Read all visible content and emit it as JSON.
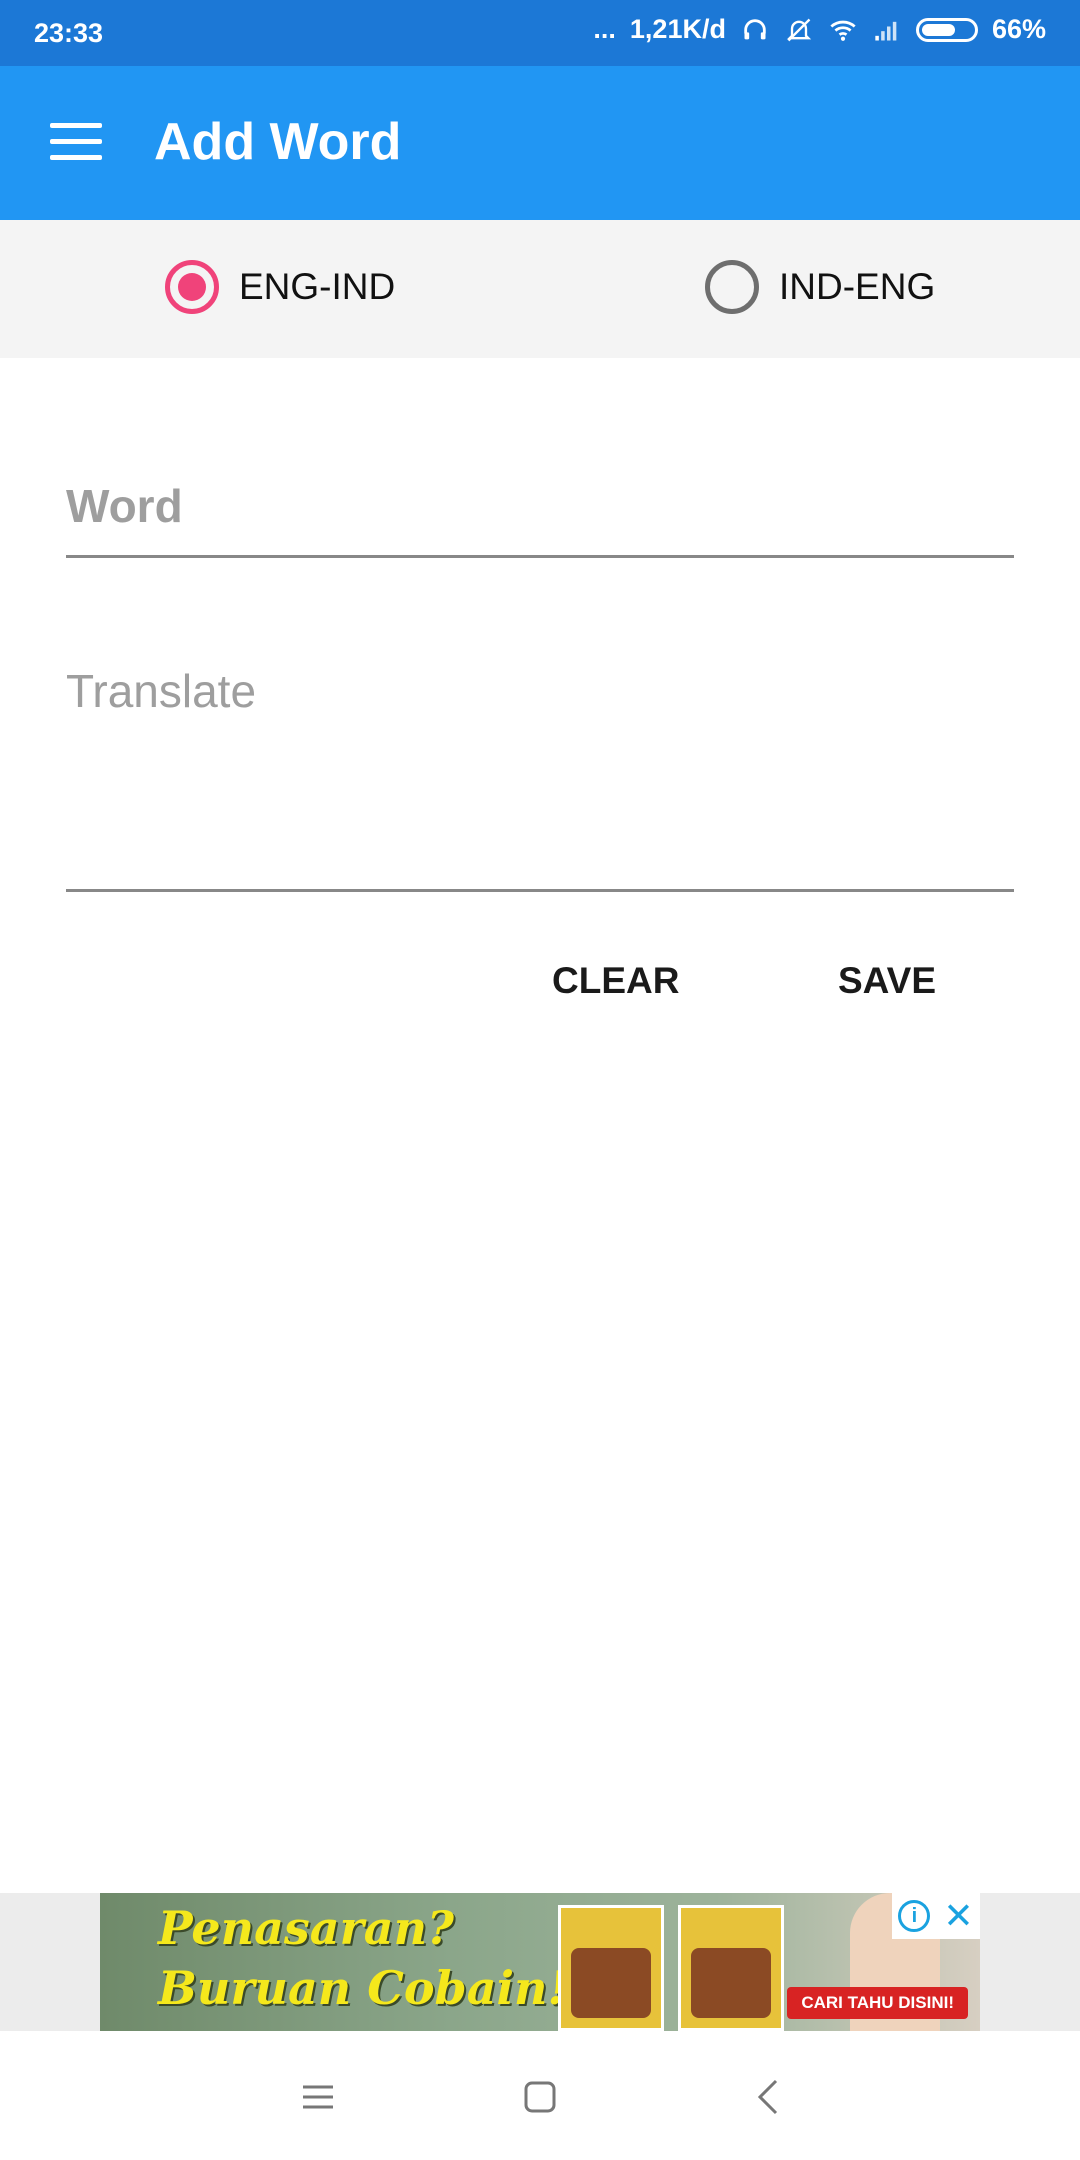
{
  "status_bar": {
    "time": "23:33",
    "more": "...",
    "network_speed": "1,21K/d",
    "battery_percent": "66%",
    "battery_level": 0.66,
    "icons": [
      "headset-icon",
      "notifications-off-icon",
      "wifi-icon",
      "signal-icon",
      "battery-icon"
    ]
  },
  "app_bar": {
    "title": "Add Word",
    "menu_icon": "menu-icon"
  },
  "direction": {
    "options": [
      {
        "label": "ENG-IND",
        "checked": true
      },
      {
        "label": "IND-ENG",
        "checked": false
      }
    ]
  },
  "form": {
    "word_placeholder": "Word",
    "word_value": "",
    "translate_placeholder": "Translate",
    "translate_value": ""
  },
  "actions": {
    "clear_label": "CLEAR",
    "save_label": "SAVE"
  },
  "ad": {
    "line1": "Penasaran?",
    "line2": "Buruan Cobain!",
    "cta": "CARI TAHU DISINI!",
    "info": "i",
    "close": "✕"
  },
  "nav": {
    "icons": [
      "recents-icon",
      "home-icon",
      "back-icon"
    ]
  },
  "colors": {
    "status_bar": "#1c78d6",
    "app_bar": "#2196f3",
    "accent": "#f0437a"
  }
}
